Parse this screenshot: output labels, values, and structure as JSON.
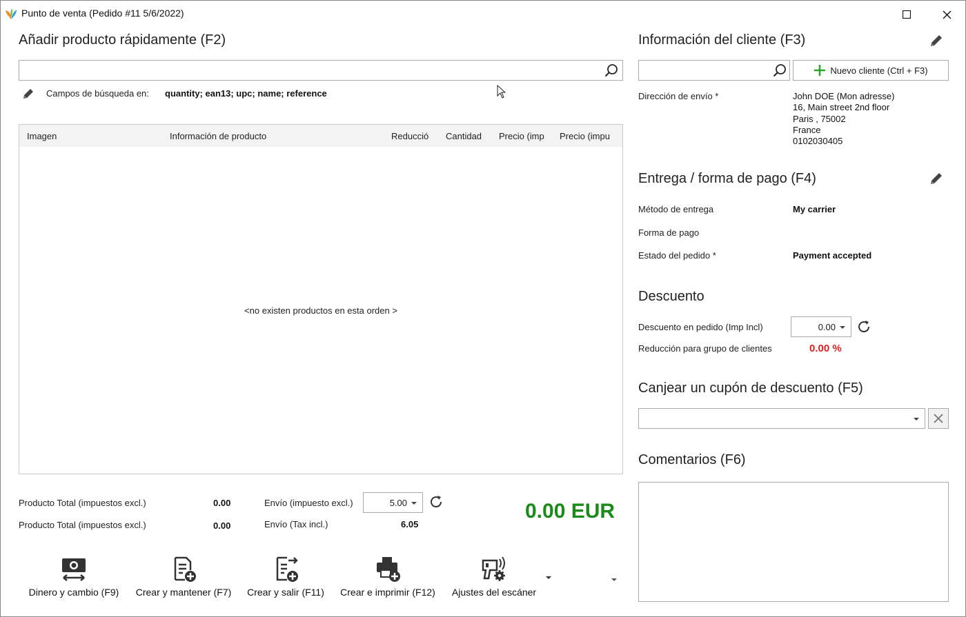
{
  "window": {
    "title": "Punto de venta (Pedido #11 5/6/2022)"
  },
  "quick_add": {
    "heading": "Añadir producto rápidamente (F2)",
    "search_value": "",
    "search_fields_label": "Campos de búsqueda en:",
    "search_fields_value": "quantity; ean13; upc; name; reference"
  },
  "table": {
    "columns": [
      "Imagen",
      "Información de producto",
      "Reducció",
      "Cantidad",
      "Precio (imp",
      "Precio (impu"
    ],
    "empty_message": "<no existen productos en esta orden >"
  },
  "totals": {
    "product_total_excl_label": "Producto Total (impuestos excl.)",
    "product_total_excl_value": "0.00",
    "product_total_incl_label": "Producto Total (impuestos excl.)",
    "product_total_incl_value": "0.00",
    "shipping_excl_label": "Envío (impuesto excl.)",
    "shipping_excl_value": "5.00",
    "shipping_incl_label": "Envío (Tax incl.)",
    "shipping_incl_value": "6.05",
    "grand_total": "0.00 EUR"
  },
  "toolbar": {
    "cash_label": "Dinero y cambio (F9)",
    "create_keep_label": "Crear y mantener (F7)",
    "create_exit_label": "Crear y salir (F11)",
    "create_print_label": "Crear e imprimir (F12)",
    "scanner_label": "Ajustes del escáner"
  },
  "customer": {
    "heading": "Información del cliente (F3)",
    "search_value": "",
    "new_customer_label": "Nuevo cliente (Ctrl + F3)",
    "shipping_address_label": "Dirección de envío *",
    "address_lines": [
      "John DOE (Mon adresse)",
      "16, Main street 2nd floor",
      "Paris ,  75002",
      "France",
      "0102030405"
    ]
  },
  "delivery": {
    "heading": "Entrega / forma de pago (F4)",
    "method_label": "Método de entrega",
    "method_value": "My carrier",
    "payment_label": "Forma de pago",
    "payment_value": "",
    "status_label": "Estado del pedido *",
    "status_value": "Payment accepted"
  },
  "discount": {
    "heading": "Descuento",
    "order_discount_label": "Descuento en pedido (Imp Incl)",
    "order_discount_value": "0.00",
    "group_reduction_label": "Reducción para grupo de clientes",
    "group_reduction_value": "0.00 %"
  },
  "coupon": {
    "heading": "Canjear un cupón de descuento (F5)",
    "value": ""
  },
  "comments": {
    "heading": "Comentarios (F6)",
    "value": ""
  },
  "colors": {
    "grand_total": "#1a8a1a",
    "reduction_value": "#e02020",
    "plus_icon": "#2aa52a"
  }
}
